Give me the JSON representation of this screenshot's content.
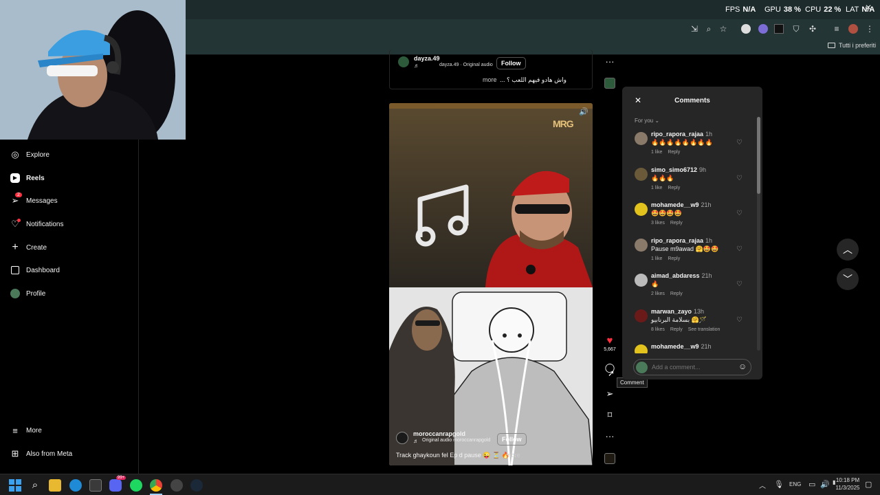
{
  "overlay": {
    "fps_label": "FPS",
    "fps": "N/A",
    "gpu_label": "GPU",
    "gpu": "38 %",
    "cpu_label": "CPU",
    "cpu": "22 %",
    "lat_label": "LAT",
    "lat": "N/A"
  },
  "bookmarks": {
    "all_favorites": "Tutti i preferiti"
  },
  "sidebar": {
    "items": [
      {
        "label": "Explore",
        "icon": "compass-icon"
      },
      {
        "label": "Reels",
        "icon": "reels-icon"
      },
      {
        "label": "Messages",
        "icon": "messenger-icon",
        "badge": "2"
      },
      {
        "label": "Notifications",
        "icon": "heart-icon"
      },
      {
        "label": "Create",
        "icon": "plus-icon"
      },
      {
        "label": "Dashboard",
        "icon": "dashboard-icon"
      },
      {
        "label": "Profile",
        "icon": "avatar-icon"
      }
    ],
    "more": "More",
    "also_from_meta": "Also from Meta"
  },
  "prev_post": {
    "username": "dayza.49",
    "audio": "dayza.49 · Original audio",
    "follow": "Follow",
    "caption": "واش هادو فيهم اللعب ؟ ...",
    "more": "more"
  },
  "reel": {
    "logo": "MRG",
    "username": "moroccanrapgold",
    "audio": "Original audio  moroccanrapgold",
    "follow": "Follow",
    "caption": "Track ghaykoun fel Ep d pause 😜 ⏳ 🔥 ...",
    "more": "more",
    "likes": "5,667",
    "tooltip": "Comment"
  },
  "comments_panel": {
    "title": "Comments",
    "filter": "For you",
    "input_placeholder": "Add a comment...",
    "items": [
      {
        "user": "ripo_rapora_rajaa",
        "time": "1h",
        "text": "🔥🔥🔥🔥🔥🔥🔥🔥",
        "likes": "1 like",
        "reply": "Reply",
        "extra": "",
        "avatar": "#8a7a6a"
      },
      {
        "user": "simo_simo6712",
        "time": "9h",
        "text": "🔥🔥🔥",
        "likes": "1 like",
        "reply": "Reply",
        "extra": "",
        "avatar": "#6b5a3a"
      },
      {
        "user": "mohamede__w9",
        "time": "21h",
        "text": "🤩🤩🤩🤩",
        "likes": "3 likes",
        "reply": "Reply",
        "extra": "",
        "avatar": "#e2c21c"
      },
      {
        "user": "ripo_rapora_rajaa",
        "time": "1h",
        "text": "Pause m9awad 🤗🤩🤩",
        "likes": "1 like",
        "reply": "Reply",
        "extra": "",
        "avatar": "#8a7a6a"
      },
      {
        "user": "aimad_abdaress",
        "time": "21h",
        "text": "🔥",
        "likes": "2 likes",
        "reply": "Reply",
        "extra": "",
        "avatar": "#bbbbbb"
      },
      {
        "user": "marwan_zayo",
        "time": "13h",
        "text": "بسلامة البرنابيو 🤗🪄",
        "likes": "8 likes",
        "reply": "Reply",
        "extra": "See translation",
        "avatar": "#6b1a1a"
      },
      {
        "user": "mohamede__w9",
        "time": "21h",
        "text": "",
        "likes": "",
        "reply": "",
        "extra": "",
        "avatar": "#e2c21c"
      }
    ]
  },
  "taskbar": {
    "lang": "ENG",
    "time": "10:18 PM",
    "date": "11/3/2025",
    "badge_teams": "99+"
  }
}
